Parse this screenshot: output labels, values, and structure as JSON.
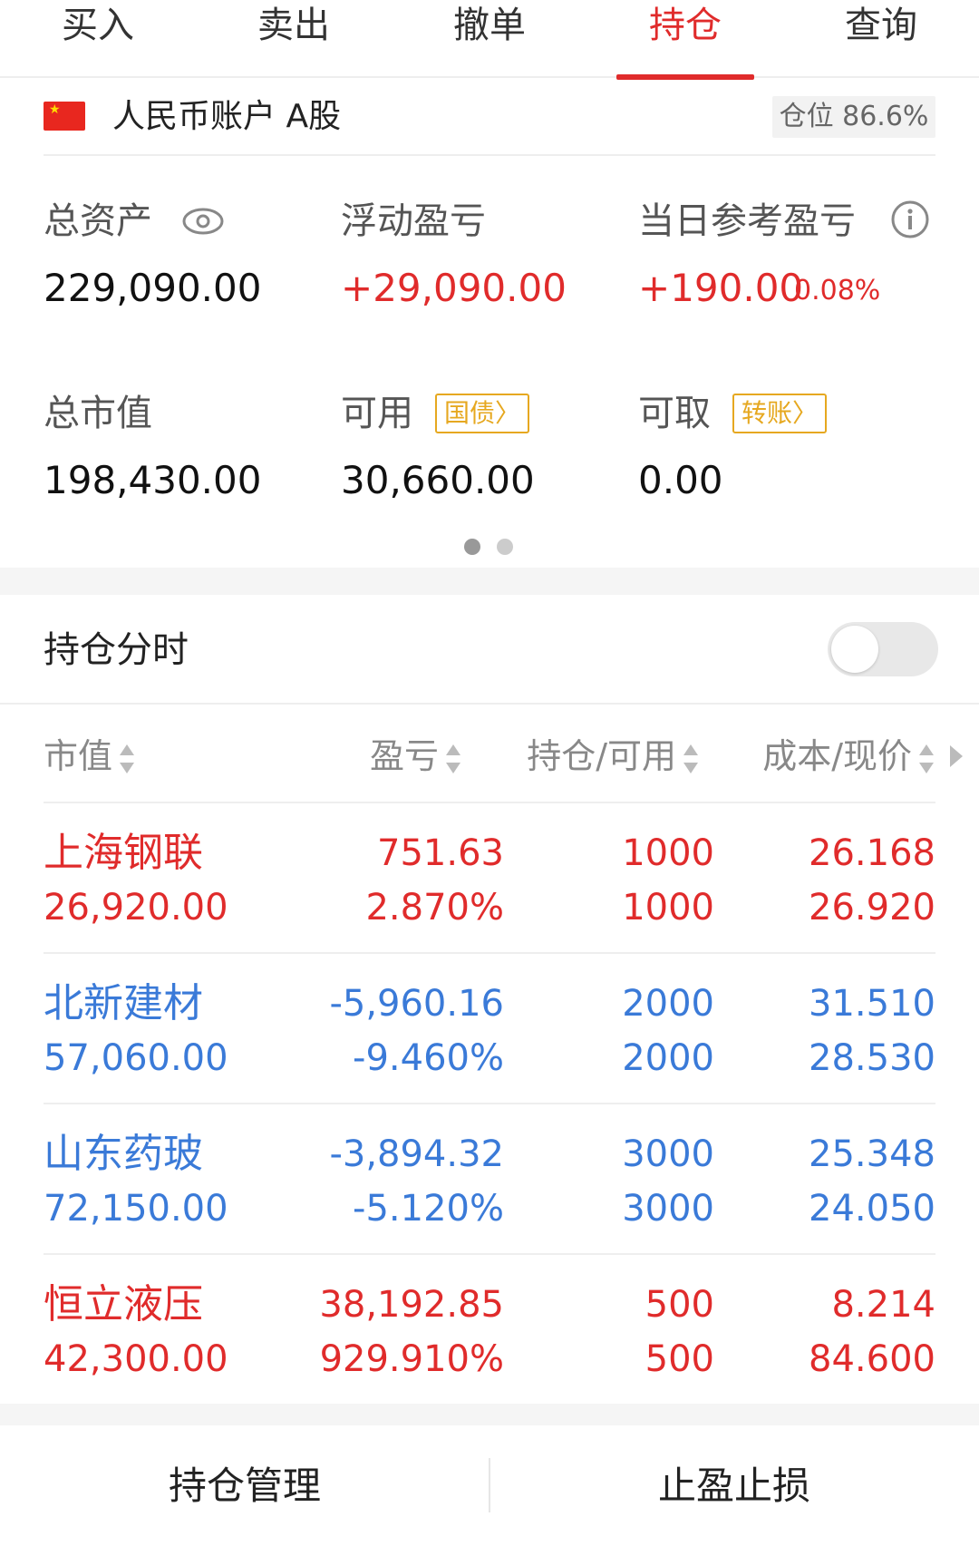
{
  "tabs": [
    {
      "label": "买入",
      "active": false
    },
    {
      "label": "卖出",
      "active": false
    },
    {
      "label": "撤单",
      "active": false
    },
    {
      "label": "持仓",
      "active": true
    },
    {
      "label": "查询",
      "active": false
    }
  ],
  "account": {
    "name": "人民币账户 A股",
    "position_ratio": "仓位 86.6%"
  },
  "summary": {
    "total_assets_label": "总资产",
    "total_assets": "229,090.00",
    "floating_pl_label": "浮动盈亏",
    "floating_pl": "+29,090.00",
    "daily_pl_label": "当日参考盈亏",
    "daily_pl": "+190.00",
    "daily_pl_pct": "0.08%",
    "market_value_label": "总市值",
    "market_value": "198,430.00",
    "available_label": "可用",
    "available": "30,660.00",
    "bond_button": "国债",
    "withdrawable_label": "可取",
    "withdrawable": "0.00",
    "transfer_button": "转账"
  },
  "carousel": {
    "pages": 2,
    "current": 1
  },
  "intraday": {
    "label": "持仓分时",
    "enabled": false
  },
  "table": {
    "headers": [
      "市值",
      "盈亏",
      "持仓/可用",
      "成本/现价"
    ],
    "rows": [
      {
        "name": "上海钢联",
        "market_value": "26,920.00",
        "pl": "751.63",
        "pl_pct": "2.870%",
        "position": "1000",
        "available": "1000",
        "cost": "26.168",
        "price": "26.920",
        "trend": "up"
      },
      {
        "name": "北新建材",
        "market_value": "57,060.00",
        "pl": "-5,960.16",
        "pl_pct": "-9.460%",
        "position": "2000",
        "available": "2000",
        "cost": "31.510",
        "price": "28.530",
        "trend": "down"
      },
      {
        "name": "山东药玻",
        "market_value": "72,150.00",
        "pl": "-3,894.32",
        "pl_pct": "-5.120%",
        "position": "3000",
        "available": "3000",
        "cost": "25.348",
        "price": "24.050",
        "trend": "down"
      },
      {
        "name": "恒立液压",
        "market_value": "42,300.00",
        "pl": "38,192.85",
        "pl_pct": "929.910%",
        "position": "500",
        "available": "500",
        "cost": "8.214",
        "price": "84.600",
        "trend": "up"
      }
    ]
  },
  "bottom": {
    "manage_label": "持仓管理",
    "stop_label": "止盈止损"
  },
  "colors": {
    "accent_red": "#e02b2b",
    "loss_blue": "#3a7ad8",
    "gold": "#e6a820"
  }
}
